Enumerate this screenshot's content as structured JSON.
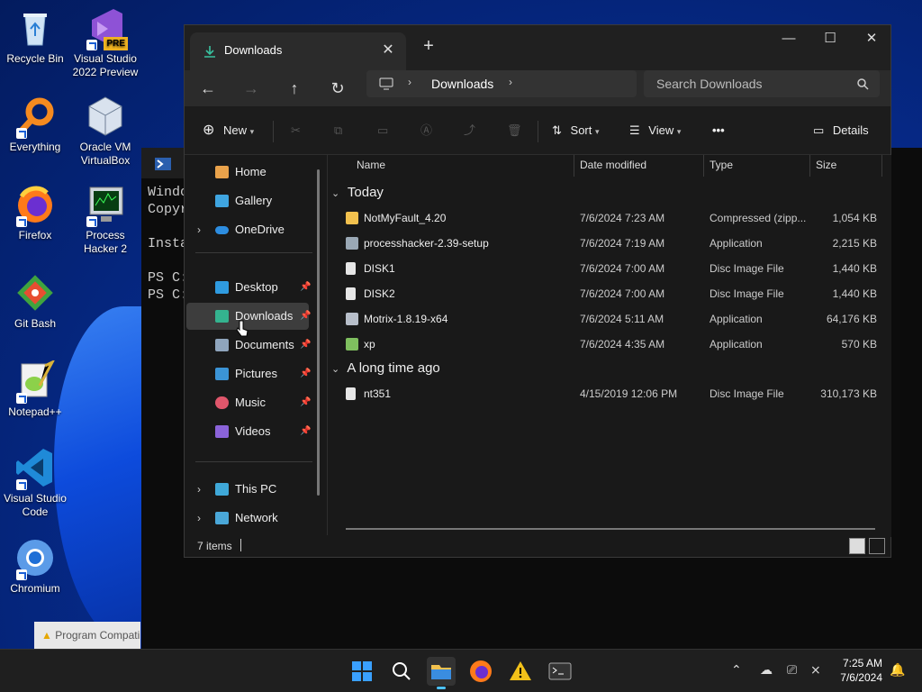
{
  "desktop": {
    "icons": [
      {
        "label": "Recycle Bin"
      },
      {
        "label": "Visual Studio 2022 Preview",
        "badge": "PRE"
      },
      {
        "label": "Everything"
      },
      {
        "label": "Oracle VM VirtualBox"
      },
      {
        "label": "Firefox"
      },
      {
        "label": "Process Hacker 2"
      },
      {
        "label": "Git Bash"
      },
      {
        "label": "Notepad++"
      },
      {
        "label": "Visual Studio Code"
      },
      {
        "label": "Chromium"
      }
    ],
    "compat_notice": "Program Compatibility Assistant"
  },
  "terminal": {
    "lines": [
      "Windo",
      "Copyr",
      "",
      "Insta",
      "",
      "PS C:",
      "PS C:"
    ]
  },
  "explorer": {
    "tab_title": "Downloads",
    "breadcrumb": "Downloads",
    "search_placeholder": "Search Downloads",
    "toolbar": {
      "new_label": "New",
      "sort_label": "Sort",
      "view_label": "View",
      "more_label": "•••",
      "details_label": "Details"
    },
    "sidebar": {
      "home": "Home",
      "gallery": "Gallery",
      "onedrive": "OneDrive",
      "desktop": "Desktop",
      "downloads": "Downloads",
      "documents": "Documents",
      "pictures": "Pictures",
      "music": "Music",
      "videos": "Videos",
      "this_pc": "This PC",
      "network": "Network"
    },
    "columns": {
      "name": "Name",
      "date": "Date modified",
      "type": "Type",
      "size": "Size"
    },
    "groups": [
      {
        "label": "Today",
        "files": [
          {
            "name": "NotMyFault_4.20",
            "date": "7/6/2024 7:23 AM",
            "type": "Compressed (zipp...",
            "size": "1,054 KB",
            "icon": "zip-folder-icon"
          },
          {
            "name": "processhacker-2.39-setup",
            "date": "7/6/2024 7:19 AM",
            "type": "Application",
            "size": "2,215 KB",
            "icon": "installer-icon"
          },
          {
            "name": "DISK1",
            "date": "7/6/2024 7:00 AM",
            "type": "Disc Image File",
            "size": "1,440 KB",
            "icon": "disc-image-icon"
          },
          {
            "name": "DISK2",
            "date": "7/6/2024 7:00 AM",
            "type": "Disc Image File",
            "size": "1,440 KB",
            "icon": "disc-image-icon"
          },
          {
            "name": "Motrix-1.8.19-x64",
            "date": "7/6/2024 5:11 AM",
            "type": "Application",
            "size": "64,176 KB",
            "icon": "app-icon"
          },
          {
            "name": "xp",
            "date": "7/6/2024 4:35 AM",
            "type": "Application",
            "size": "570 KB",
            "icon": "app-icon"
          }
        ]
      },
      {
        "label": "A long time ago",
        "files": [
          {
            "name": "nt351",
            "date": "4/15/2019 12:06 PM",
            "type": "Disc Image File",
            "size": "310,173 KB",
            "icon": "disc-image-icon"
          }
        ]
      }
    ],
    "status": "7 items"
  },
  "taskbar": {
    "time": "7:25 AM",
    "date": "7/6/2024"
  },
  "colors": {
    "accent": "#4cc2ff",
    "folder": "#f2c14e",
    "selection": "#3d3d3d"
  }
}
